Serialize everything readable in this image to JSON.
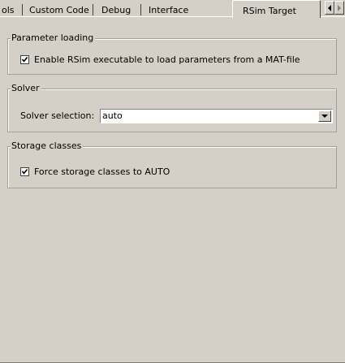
{
  "tabs": {
    "items": [
      {
        "label": "ols"
      },
      {
        "label": "Custom Code"
      },
      {
        "label": "Debug"
      },
      {
        "label": "Interface"
      },
      {
        "label": "RSim Target",
        "active": true
      }
    ]
  },
  "param_group": {
    "title": "Parameter loading",
    "checkbox_label": "Enable RSim executable to load parameters from a MAT-file",
    "checked": true
  },
  "solver_group": {
    "title": "Solver",
    "label": "Solver selection:",
    "selected": "auto"
  },
  "storage_group": {
    "title": "Storage classes",
    "checkbox_label": "Force storage classes to AUTO",
    "checked": true
  },
  "icons": {
    "scroll_left": "triangle-left-icon",
    "scroll_right": "triangle-right-icon",
    "dropdown": "chevron-down-icon",
    "check": "check-icon"
  }
}
